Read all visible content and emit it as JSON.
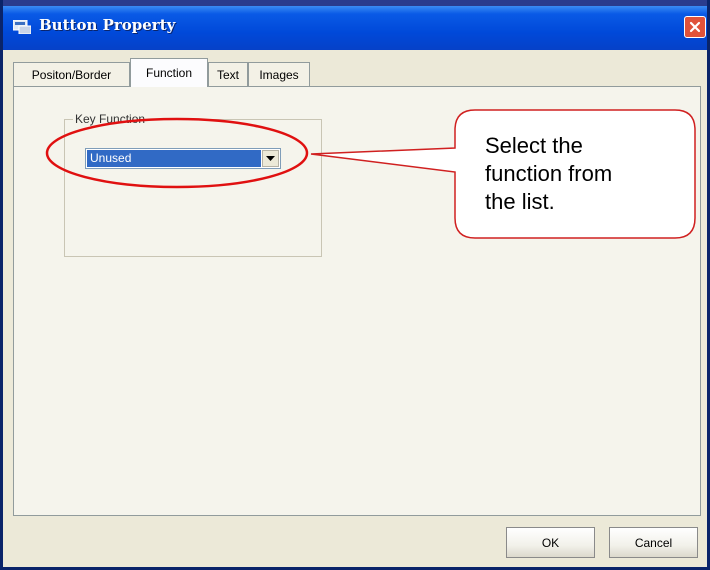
{
  "window": {
    "title": "Button Property",
    "close_icon": "close-icon",
    "app_icon": "button-property-icon"
  },
  "tabs": [
    {
      "label": "Positon/Border",
      "active": false
    },
    {
      "label": "Function",
      "active": true
    },
    {
      "label": "Text",
      "active": false
    },
    {
      "label": "Images",
      "active": false
    }
  ],
  "key_function": {
    "group_label": "Key Function",
    "selected_value": "Unused"
  },
  "callout": {
    "text_line1": "Select the",
    "text_line2": "function from",
    "text_line3": "the list.",
    "color": "#e01010"
  },
  "buttons": {
    "ok_label": "OK",
    "cancel_label": "Cancel"
  }
}
